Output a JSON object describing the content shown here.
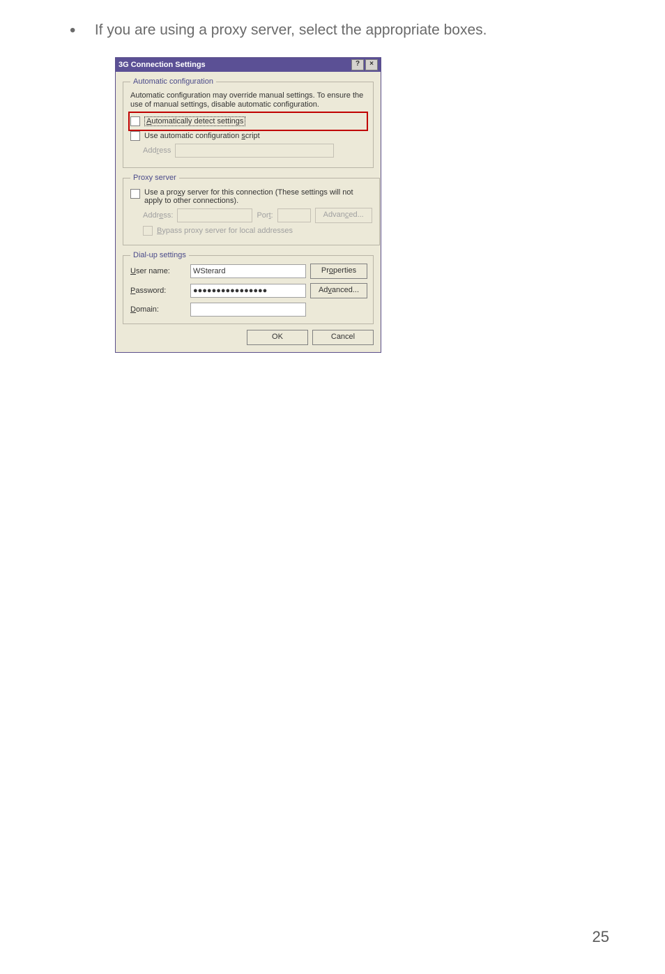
{
  "instruction_text": "If you are using a proxy server, select the appropriate boxes.",
  "page_number": "25",
  "dialog": {
    "title": "3G Connection Settings",
    "help_icon": "?",
    "close_icon": "×",
    "auto_config": {
      "legend": "Automatic configuration",
      "description": "Automatic configuration may override manual settings. To ensure the use of manual settings, disable automatic configuration.",
      "check_auto_detect": "Automatically detect settings",
      "check_auto_script": "Use automatic configuration script",
      "address_label": "Address"
    },
    "proxy": {
      "legend": "Proxy server",
      "check_use_proxy": "Use a proxy server for this connection (These settings will not apply to other connections).",
      "address_label": "Address:",
      "port_label": "Port:",
      "advanced_btn": "Advanced...",
      "check_bypass": "Bypass proxy server for local addresses"
    },
    "dialup": {
      "legend": "Dial-up settings",
      "username_label": "User name:",
      "username_value": "WSterard",
      "password_label": "Password:",
      "password_value": "●●●●●●●●●●●●●●●●",
      "domain_label": "Domain:",
      "domain_value": "",
      "properties_btn": "Properties",
      "advanced_btn": "Advanced..."
    },
    "ok_btn": "OK",
    "cancel_btn": "Cancel"
  }
}
